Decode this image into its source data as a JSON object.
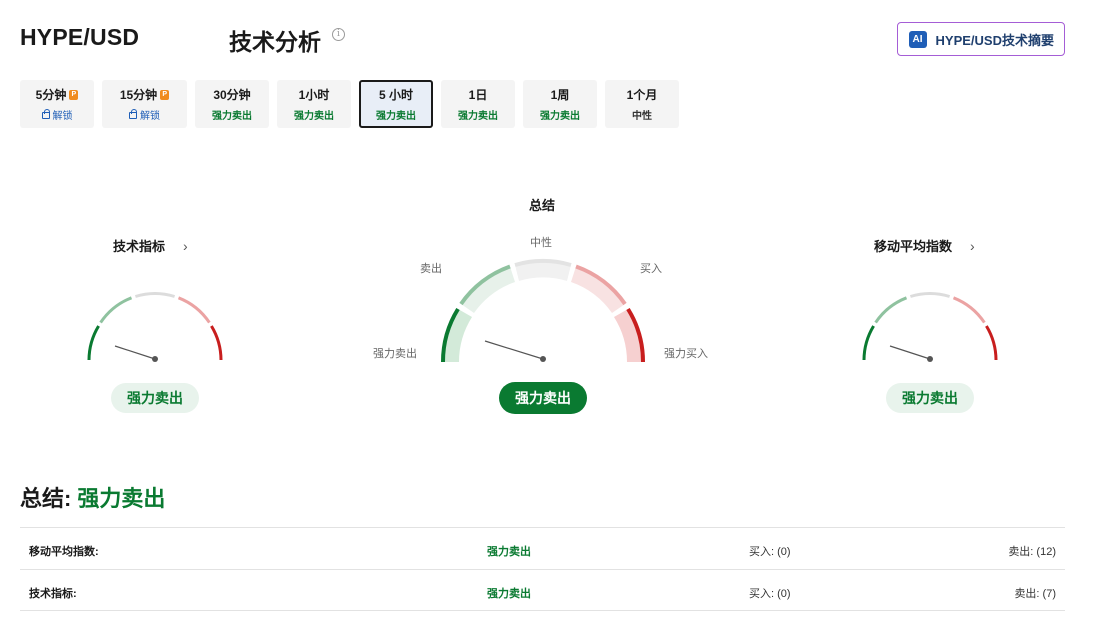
{
  "header": {
    "pair": "HYPE/USD",
    "section_title": "技术分析",
    "ai_badge": "AI",
    "ai_button_label": "HYPE/USD技术摘要"
  },
  "tabs": [
    {
      "label": "5分钟",
      "status": "解锁",
      "type": "locked"
    },
    {
      "label": "15分钟",
      "status": "解锁",
      "type": "locked"
    },
    {
      "label": "30分钟",
      "status": "强力卖出",
      "type": "sell"
    },
    {
      "label": "1小时",
      "status": "强力卖出",
      "type": "sell"
    },
    {
      "label": "5 小时",
      "status": "强力卖出",
      "type": "sell",
      "active": true
    },
    {
      "label": "1日",
      "status": "强力卖出",
      "type": "sell"
    },
    {
      "label": "1周",
      "status": "强力卖出",
      "type": "sell"
    },
    {
      "label": "1个月",
      "status": "中性",
      "type": "neutral"
    }
  ],
  "gauges": {
    "technical": {
      "title": "技术指标",
      "result": "强力卖出"
    },
    "summary": {
      "title": "总结",
      "result": "强力卖出",
      "labels": {
        "neutral": "中性",
        "sell": "卖出",
        "buy": "买入",
        "strong_sell": "强力卖出",
        "strong_buy": "强力买入"
      }
    },
    "moving_avg": {
      "title": "移动平均指数",
      "result": "强力卖出"
    }
  },
  "summary": {
    "label": "总结:",
    "value": "强力卖出"
  },
  "table": [
    {
      "name": "移动平均指数:",
      "signal": "强力卖出",
      "buy": "买入: (0)",
      "sell": "卖出: (12)"
    },
    {
      "name": "技术指标:",
      "signal": "强力卖出",
      "buy": "买入: (0)",
      "sell": "卖出: (7)"
    }
  ],
  "colors": {
    "strong_sell": "#0a7a31",
    "sell": "#8fc29f",
    "neutral": "#dcdcdc",
    "buy": "#eba3a3",
    "strong_buy": "#c81e1e",
    "ai_border": "#a55dd6"
  }
}
